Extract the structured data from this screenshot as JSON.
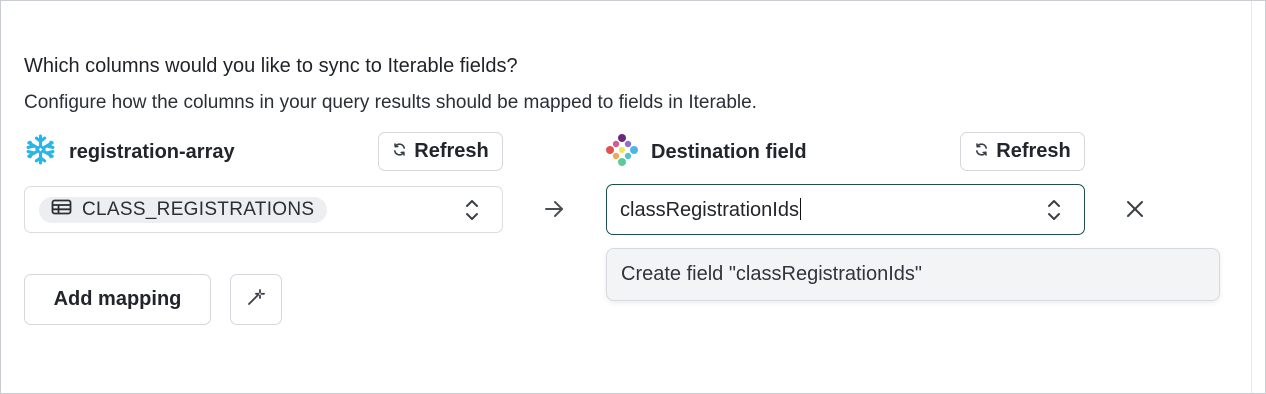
{
  "form": {
    "question": "Which columns would you like to sync to Iterable fields?",
    "description": "Configure how the columns in your query results should be mapped to fields in Iterable."
  },
  "source": {
    "icon": "snowflake-icon",
    "label": "registration-array",
    "refresh_label": "Refresh",
    "selected_column": "CLASS_REGISTRATIONS",
    "column_icon": "table-icon",
    "accent_color": "#29b5e8"
  },
  "destination": {
    "icon": "iterable-logo-icon",
    "label": "Destination field",
    "refresh_label": "Refresh",
    "input_value": "classRegistrationIds",
    "dropdown_option": "Create field \"classRegistrationIds\"",
    "focus_border_color": "#1f4c4f"
  },
  "actions": {
    "add_mapping_label": "Add mapping",
    "magic_icon": "magic-wand-icon",
    "arrow_icon": "arrow-right-icon",
    "clear_icon": "close-icon"
  }
}
